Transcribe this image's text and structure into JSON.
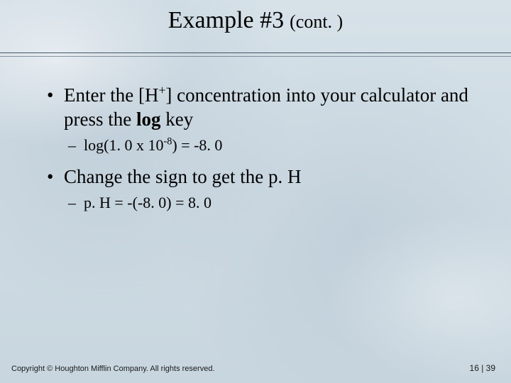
{
  "title": {
    "main": "Example #3",
    "sub": "(cont. )"
  },
  "content": {
    "b1_pre": "Enter the [H",
    "b1_sup": "+",
    "b1_mid": "] concentration into your calculator and press the ",
    "b1_bold": "log",
    "b1_post": " key",
    "s1_pre": "log(1. 0 x 10",
    "s1_sup": "-8",
    "s1_post": ") = -8. 0",
    "b2": "Change the sign to get the p. H",
    "s2": "p. H = -(-8. 0) = 8. 0"
  },
  "footer": {
    "copyright": "Copyright © Houghton Mifflin Company. All rights reserved.",
    "page": "16 | 39"
  }
}
